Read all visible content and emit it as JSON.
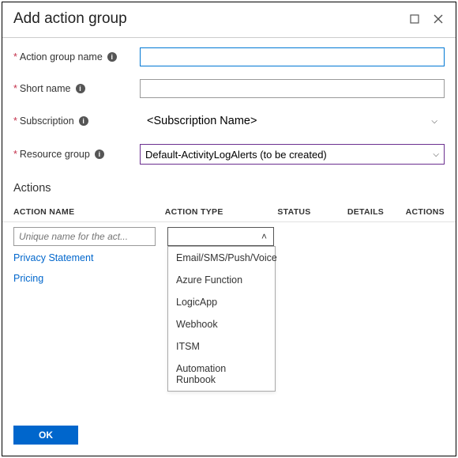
{
  "title": "Add action group",
  "fields": {
    "action_group_name": {
      "label": "Action group name",
      "value": ""
    },
    "short_name": {
      "label": "Short name",
      "value": ""
    },
    "subscription": {
      "label": "Subscription",
      "value": "<Subscription Name>"
    },
    "resource_group": {
      "label": "Resource group",
      "value": "Default-ActivityLogAlerts (to be created)"
    }
  },
  "actions_section": {
    "title": "Actions",
    "columns": {
      "name": "ACTION NAME",
      "type": "ACTION TYPE",
      "status": "STATUS",
      "details": "DETAILS",
      "actions": "ACTIONS"
    },
    "name_placeholder": "Unique name for the act...",
    "type_options": [
      "Email/SMS/Push/Voice",
      "Azure Function",
      "LogicApp",
      "Webhook",
      "ITSM",
      "Automation Runbook"
    ]
  },
  "links": {
    "privacy": "Privacy Statement",
    "pricing": "Pricing"
  },
  "footer": {
    "ok": "OK"
  }
}
